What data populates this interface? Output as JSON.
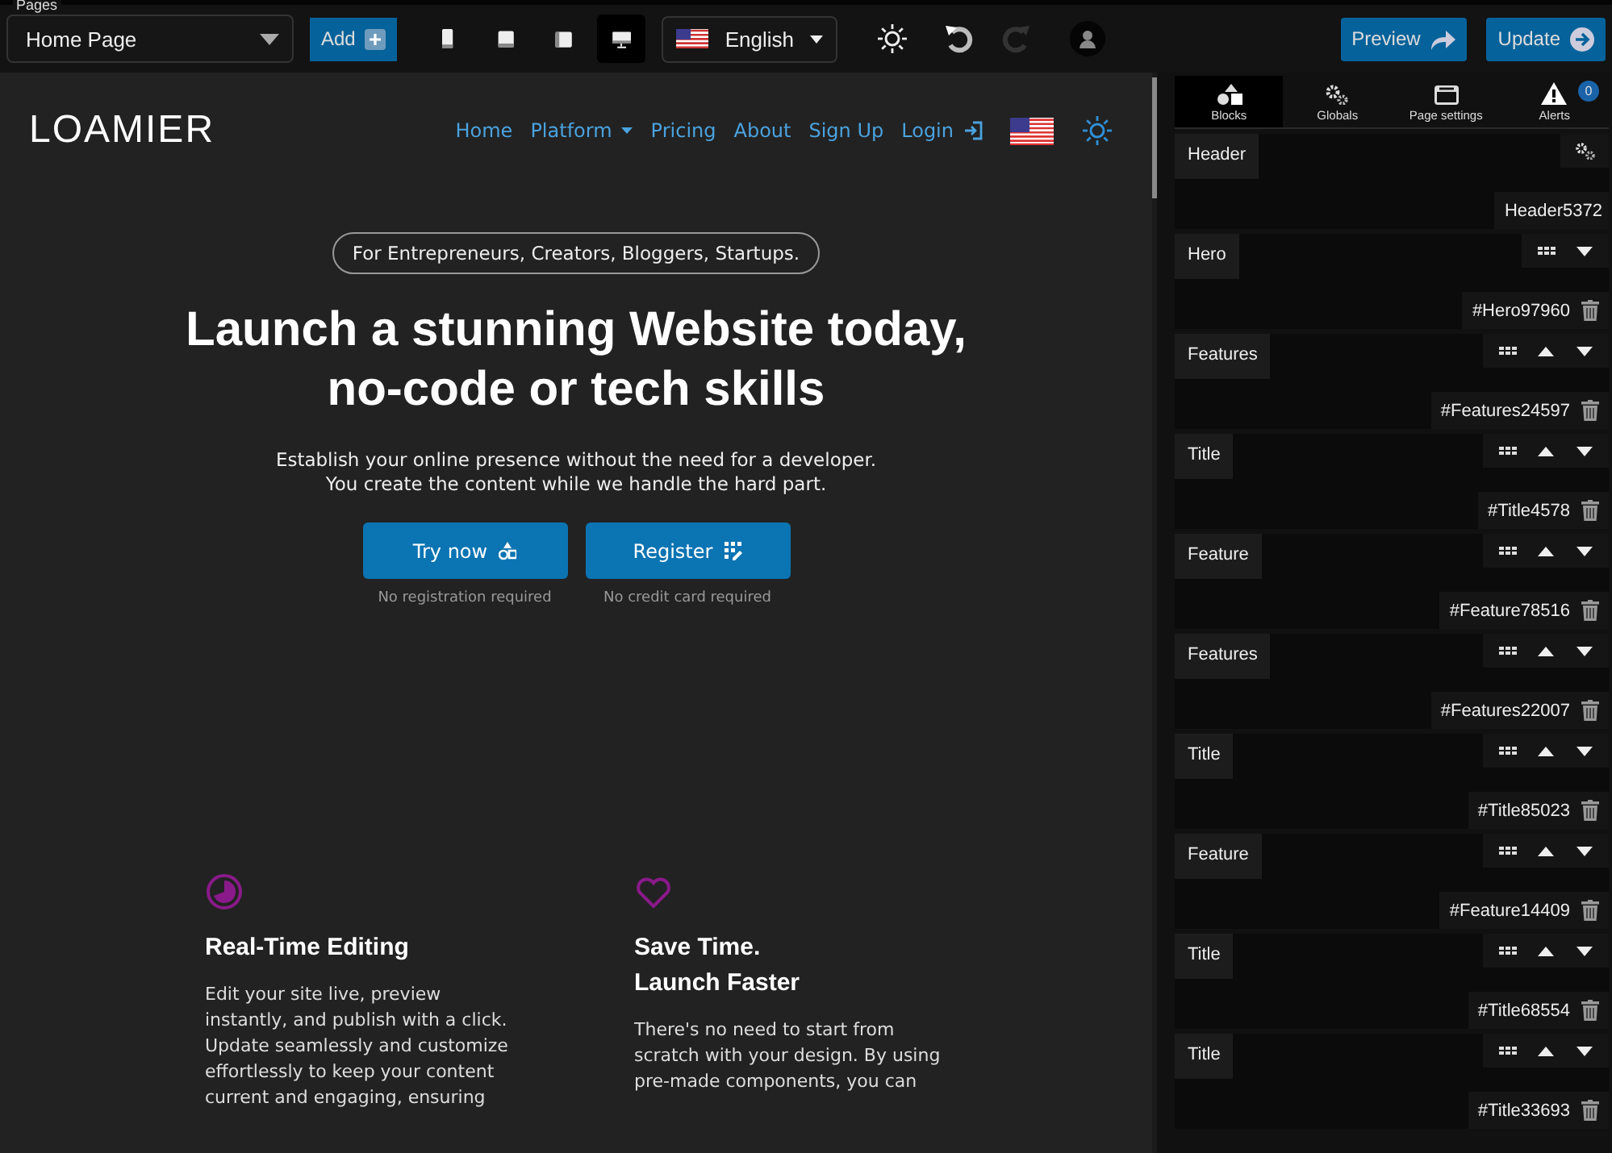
{
  "toolbar": {
    "pages_label": "Pages",
    "page": "Home Page",
    "add": "Add",
    "devices": [
      {
        "kind": "phone",
        "selected": false
      },
      {
        "kind": "tablet",
        "selected": false
      },
      {
        "kind": "tablet-landscape",
        "selected": false
      },
      {
        "kind": "desktop",
        "selected": true
      }
    ],
    "language": "English",
    "redo_disabled": true,
    "undo_disabled": false,
    "preview": "Preview",
    "update": "Update"
  },
  "site": {
    "logo": "LOAMIER",
    "nav": [
      {
        "label": "Home",
        "kind": "link"
      },
      {
        "label": "Platform",
        "kind": "dropdown"
      },
      {
        "label": "Pricing",
        "kind": "link"
      },
      {
        "label": "About",
        "kind": "link"
      },
      {
        "label": "Sign Up",
        "kind": "link"
      },
      {
        "label": "Login",
        "kind": "login"
      }
    ],
    "pill": "For Entrepreneurs, Creators, Bloggers, Startups.",
    "title": [
      "Launch a stunning Website today,",
      "no-code or tech skills"
    ],
    "subtitle": [
      "Establish your online presence without the need for a developer.",
      "You create the content while we handle the hard part."
    ],
    "ctas": [
      {
        "label": "Try now",
        "kind": "shapes",
        "note": "No registration required"
      },
      {
        "label": "Register",
        "kind": "grid",
        "note": "No credit card required"
      }
    ],
    "features": [
      {
        "kind": "clock",
        "title": [
          "Real-Time Editing"
        ],
        "text": [
          "Edit your site live, preview",
          "instantly, and publish with a click.",
          "Update seamlessly and customize",
          "effortlessly to keep your content",
          "current and engaging, ensuring"
        ]
      },
      {
        "kind": "heart",
        "title": [
          "Save Time.",
          "Launch Faster"
        ],
        "text": [
          "There's no need to start from",
          "scratch with your design. By using",
          "pre-made components, you can"
        ]
      }
    ]
  },
  "panel": {
    "tabs": [
      {
        "label": "Blocks",
        "kind": "blocks",
        "selected": true
      },
      {
        "label": "Globals",
        "kind": "globals",
        "selected": false
      },
      {
        "label": "Page settings",
        "kind": "page",
        "selected": false
      },
      {
        "label": "Alerts",
        "kind": "alerts",
        "selected": false,
        "badge": "0"
      }
    ],
    "blocks": [
      {
        "name": "Header",
        "id": "Header5372",
        "kind": "fixed"
      },
      {
        "name": "Hero",
        "id": "#Hero97960",
        "kind": "first"
      },
      {
        "name": "Features",
        "id": "#Features24597",
        "kind": "movable"
      },
      {
        "name": "Title",
        "id": "#Title4578",
        "kind": "movable"
      },
      {
        "name": "Feature",
        "id": "#Feature78516",
        "kind": "movable"
      },
      {
        "name": "Features",
        "id": "#Features22007",
        "kind": "movable"
      },
      {
        "name": "Title",
        "id": "#Title85023",
        "kind": "movable"
      },
      {
        "name": "Feature",
        "id": "#Feature14409",
        "kind": "movable"
      },
      {
        "name": "Title",
        "id": "#Title68554",
        "kind": "movable"
      },
      {
        "name": "Title",
        "id": "#Title33693",
        "kind": "movable"
      }
    ]
  }
}
